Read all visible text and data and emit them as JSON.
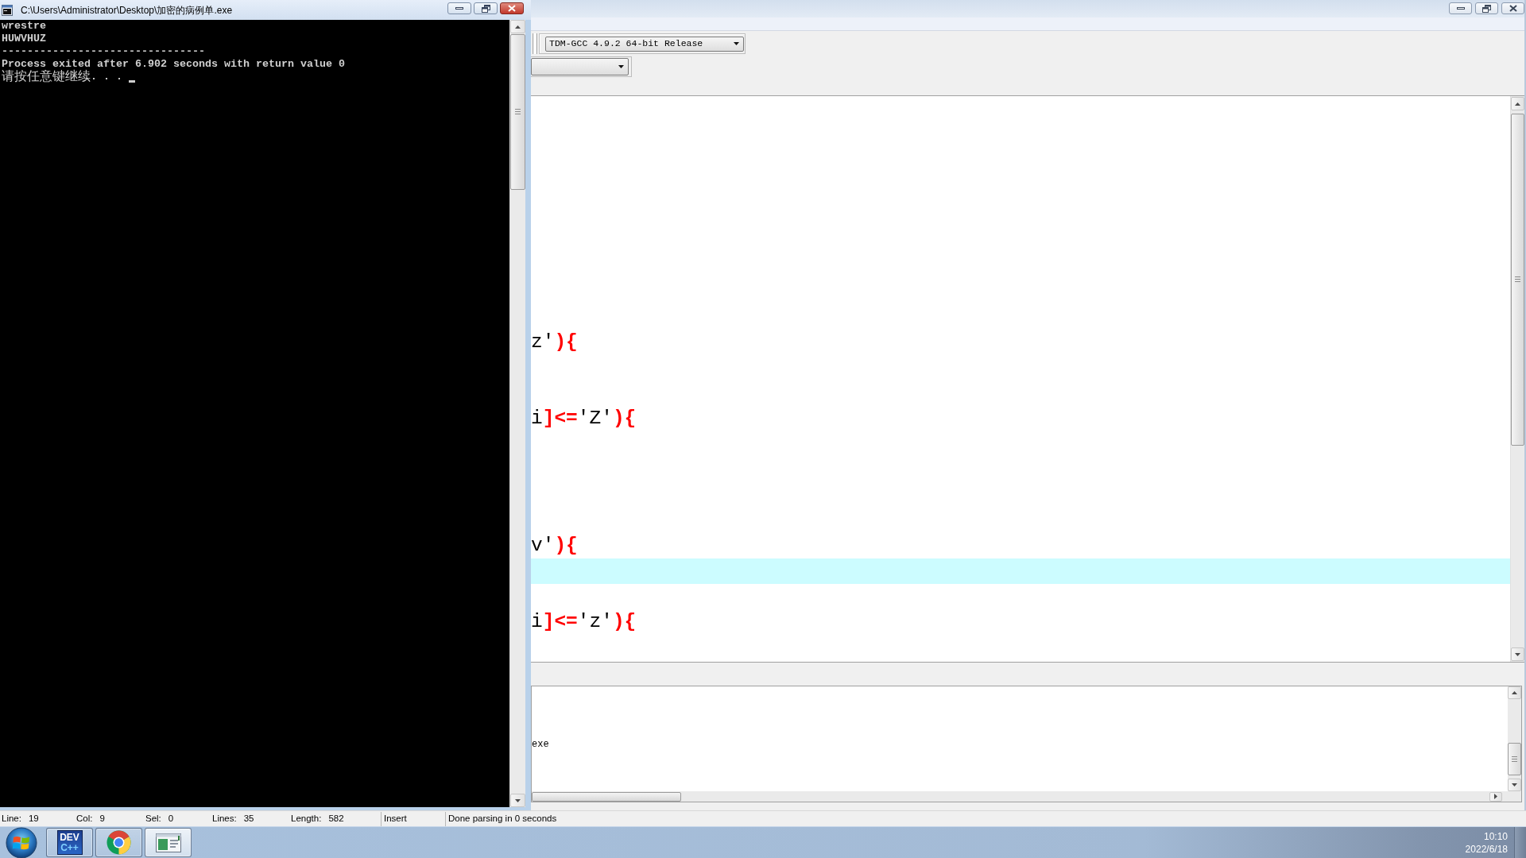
{
  "console_window": {
    "title": "C:\\Users\\Administrator\\Desktop\\加密的病例单.exe",
    "output_lines": [
      "wrestre",
      "HUWVHUZ",
      "--------------------------------",
      "Process exited after 6.902 seconds with return value 0",
      "请按任意键继续. . ."
    ]
  },
  "ide_window": {
    "compiler": "TDM-GCC 4.9.2 64-bit Release",
    "editor": {
      "lines": [
        {
          "current": false
        },
        {
          "current": false
        },
        {
          "current": false
        },
        {
          "current": false
        },
        {
          "current": false
        },
        {
          "current": false
        },
        {
          "current": false
        },
        {
          "current": false
        },
        {
          "current": false
        },
        {
          "current": false,
          "tokens": [
            {
              "kind": "plain",
              "text": "z'"
            },
            {
              "kind": "symbol",
              "text": "){"
            }
          ]
        },
        {
          "current": false
        },
        {
          "current": false
        },
        {
          "current": false,
          "tokens": [
            {
              "kind": "plain",
              "text": "i"
            },
            {
              "kind": "symbol",
              "text": "]<="
            },
            {
              "kind": "plain",
              "text": "'Z'"
            },
            {
              "kind": "symbol",
              "text": "){"
            }
          ]
        },
        {
          "current": false
        },
        {
          "current": false
        },
        {
          "current": false
        },
        {
          "current": false
        },
        {
          "current": false,
          "tokens": [
            {
              "kind": "plain",
              "text": "v'"
            },
            {
              "kind": "symbol",
              "text": "){"
            }
          ]
        },
        {
          "current": true
        },
        {
          "current": false
        },
        {
          "current": false,
          "tokens": [
            {
              "kind": "plain",
              "text": "i"
            },
            {
              "kind": "symbol",
              "text": "]<="
            },
            {
              "kind": "plain",
              "text": "'z'"
            },
            {
              "kind": "symbol",
              "text": "){"
            }
          ]
        },
        {
          "current": false
        }
      ]
    },
    "compile_log": {
      "text": "exe"
    },
    "status_bar": {
      "fields": [
        {
          "label": "Line:",
          "value": "19"
        },
        {
          "label": "Col:",
          "value": "9"
        },
        {
          "label": "Sel:",
          "value": "0"
        },
        {
          "label": "Lines:",
          "value": "35"
        },
        {
          "label": "Length:",
          "value": "582"
        }
      ],
      "mode": "Insert",
      "message": "Done parsing in 0 seconds"
    }
  },
  "taskbar": {
    "items": [
      {
        "kind": "devcpp",
        "logo_text": [
          "DEV",
          "C++"
        ],
        "selected": false
      },
      {
        "kind": "chrome",
        "selected": false
      },
      {
        "kind": "console",
        "selected": true
      }
    ],
    "clock": {
      "time": "10:10",
      "date": "2022/6/18"
    }
  }
}
